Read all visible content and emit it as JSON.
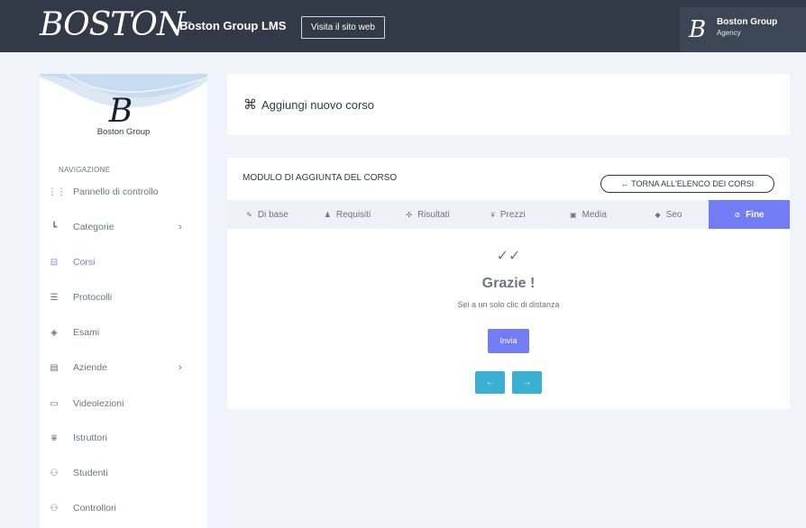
{
  "topbar": {
    "logo": "BOSTON",
    "logo_mark": "™",
    "app_title": "Boston Group LMS",
    "visit_label": "Visita il sito web",
    "profile_avatar": "B",
    "profile_name": "Boston Group",
    "profile_role": "Agency"
  },
  "sidebar": {
    "logo_glyph": "B",
    "brand": "Boston Group",
    "heading": "NAVIGAZIONE",
    "items": [
      {
        "label": "Pannello di controllo",
        "icon": "grid-icon",
        "glyph": "⋮⋮",
        "active": false,
        "chevron": false
      },
      {
        "label": "Categorie",
        "icon": "tree-icon",
        "glyph": "┗",
        "active": false,
        "chevron": true
      },
      {
        "label": "Corsi",
        "icon": "basket-icon",
        "glyph": "⊟",
        "active": true,
        "chevron": false
      },
      {
        "label": "Protocolli",
        "icon": "list-icon",
        "glyph": "☰",
        "active": false,
        "chevron": false
      },
      {
        "label": "Esami",
        "icon": "graduation-icon",
        "glyph": "◈",
        "active": false,
        "chevron": false
      },
      {
        "label": "Aziende",
        "icon": "building-icon",
        "glyph": "▤",
        "active": false,
        "chevron": true
      },
      {
        "label": "Videolezioni",
        "icon": "video-icon",
        "glyph": "▭",
        "active": false,
        "chevron": false
      },
      {
        "label": "Istruttori",
        "icon": "instructor-icon",
        "glyph": "⩸",
        "active": false,
        "chevron": false
      },
      {
        "label": "Studenti",
        "icon": "users-icon",
        "glyph": "⚇",
        "active": false,
        "chevron": false
      },
      {
        "label": "Controllori",
        "icon": "controllers-icon",
        "glyph": "⚇",
        "active": false,
        "chevron": false
      }
    ],
    "chevron_glyph": "›"
  },
  "header": {
    "icon_glyph": "⌘",
    "title": "Aggiungi nuovo corso"
  },
  "form": {
    "title": "MODULO DI AGGIUNTA DEL CORSO",
    "back_label": "← TORNA ALL'ELENCO DEI CORSI",
    "tabs": [
      {
        "label": "Di base",
        "icon": "pencil-icon",
        "glyph": "✎",
        "active": false
      },
      {
        "label": "Requisiti",
        "icon": "bell-icon",
        "glyph": "♟",
        "active": false
      },
      {
        "label": "Risultati",
        "icon": "target-icon",
        "glyph": "✣",
        "active": false
      },
      {
        "label": "Prezzi",
        "icon": "currency-icon",
        "glyph": "¥",
        "active": false
      },
      {
        "label": "Media",
        "icon": "media-icon",
        "glyph": "▣",
        "active": false
      },
      {
        "label": "Seo",
        "icon": "tag-icon",
        "glyph": "◆",
        "active": false
      },
      {
        "label": "Fine",
        "icon": "check-circle-icon",
        "glyph": "⊘",
        "active": true
      }
    ],
    "done_check": "✓✓",
    "done_title": "Grazie !",
    "done_sub": "Sei a un solo clic di distanza",
    "submit_label": "Invia",
    "prev_glyph": "←",
    "next_glyph": "→"
  },
  "colors": {
    "topbar": "#313a46",
    "primary": "#727cf5",
    "info": "#39afd1",
    "background": "#f1f3fa"
  }
}
